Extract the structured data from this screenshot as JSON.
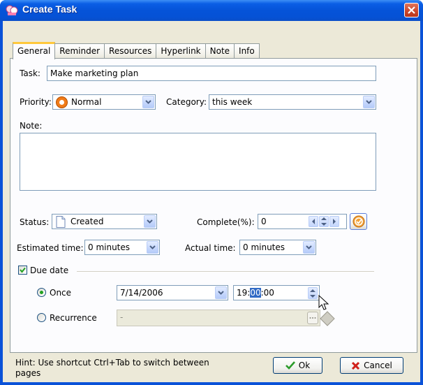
{
  "window": {
    "title": "Create Task"
  },
  "tabs": [
    "General",
    "Reminder",
    "Resources",
    "Hyperlink",
    "Note",
    "Info"
  ],
  "general": {
    "task_label": "Task:",
    "task_value": "Make marketing plan",
    "priority_label": "Priority:",
    "priority_value": "Normal",
    "category_label": "Category:",
    "category_value": "this week",
    "note_label": "Note:",
    "note_value": "",
    "status_label": "Status:",
    "status_value": "Created",
    "complete_label": "Complete(%):",
    "complete_value": "0",
    "estimated_label": "Estimated time:",
    "estimated_value": "0 minutes",
    "actual_label": "Actual time:",
    "actual_value": "0 minutes",
    "due_date_label": "Due date",
    "due_date_checked": true,
    "once_label": "Once",
    "once_selected": true,
    "date_value": "7/14/2006",
    "time_hour": "19:",
    "time_minute": "00",
    "time_second": ":00",
    "recurrence_label": "Recurrence",
    "recurrence_value": "-"
  },
  "footer": {
    "hint_line1": "Hint: Use shortcut Ctrl+Tab to switch between",
    "hint_line2": "pages",
    "ok_label": "Ok",
    "cancel_label": "Cancel"
  },
  "colors": {
    "titlebar": "#0553d8",
    "face": "#ece9d8",
    "priority_orange": "#f07b18",
    "ok_check": "#2b9b2b",
    "cancel_x": "#d0201a"
  }
}
